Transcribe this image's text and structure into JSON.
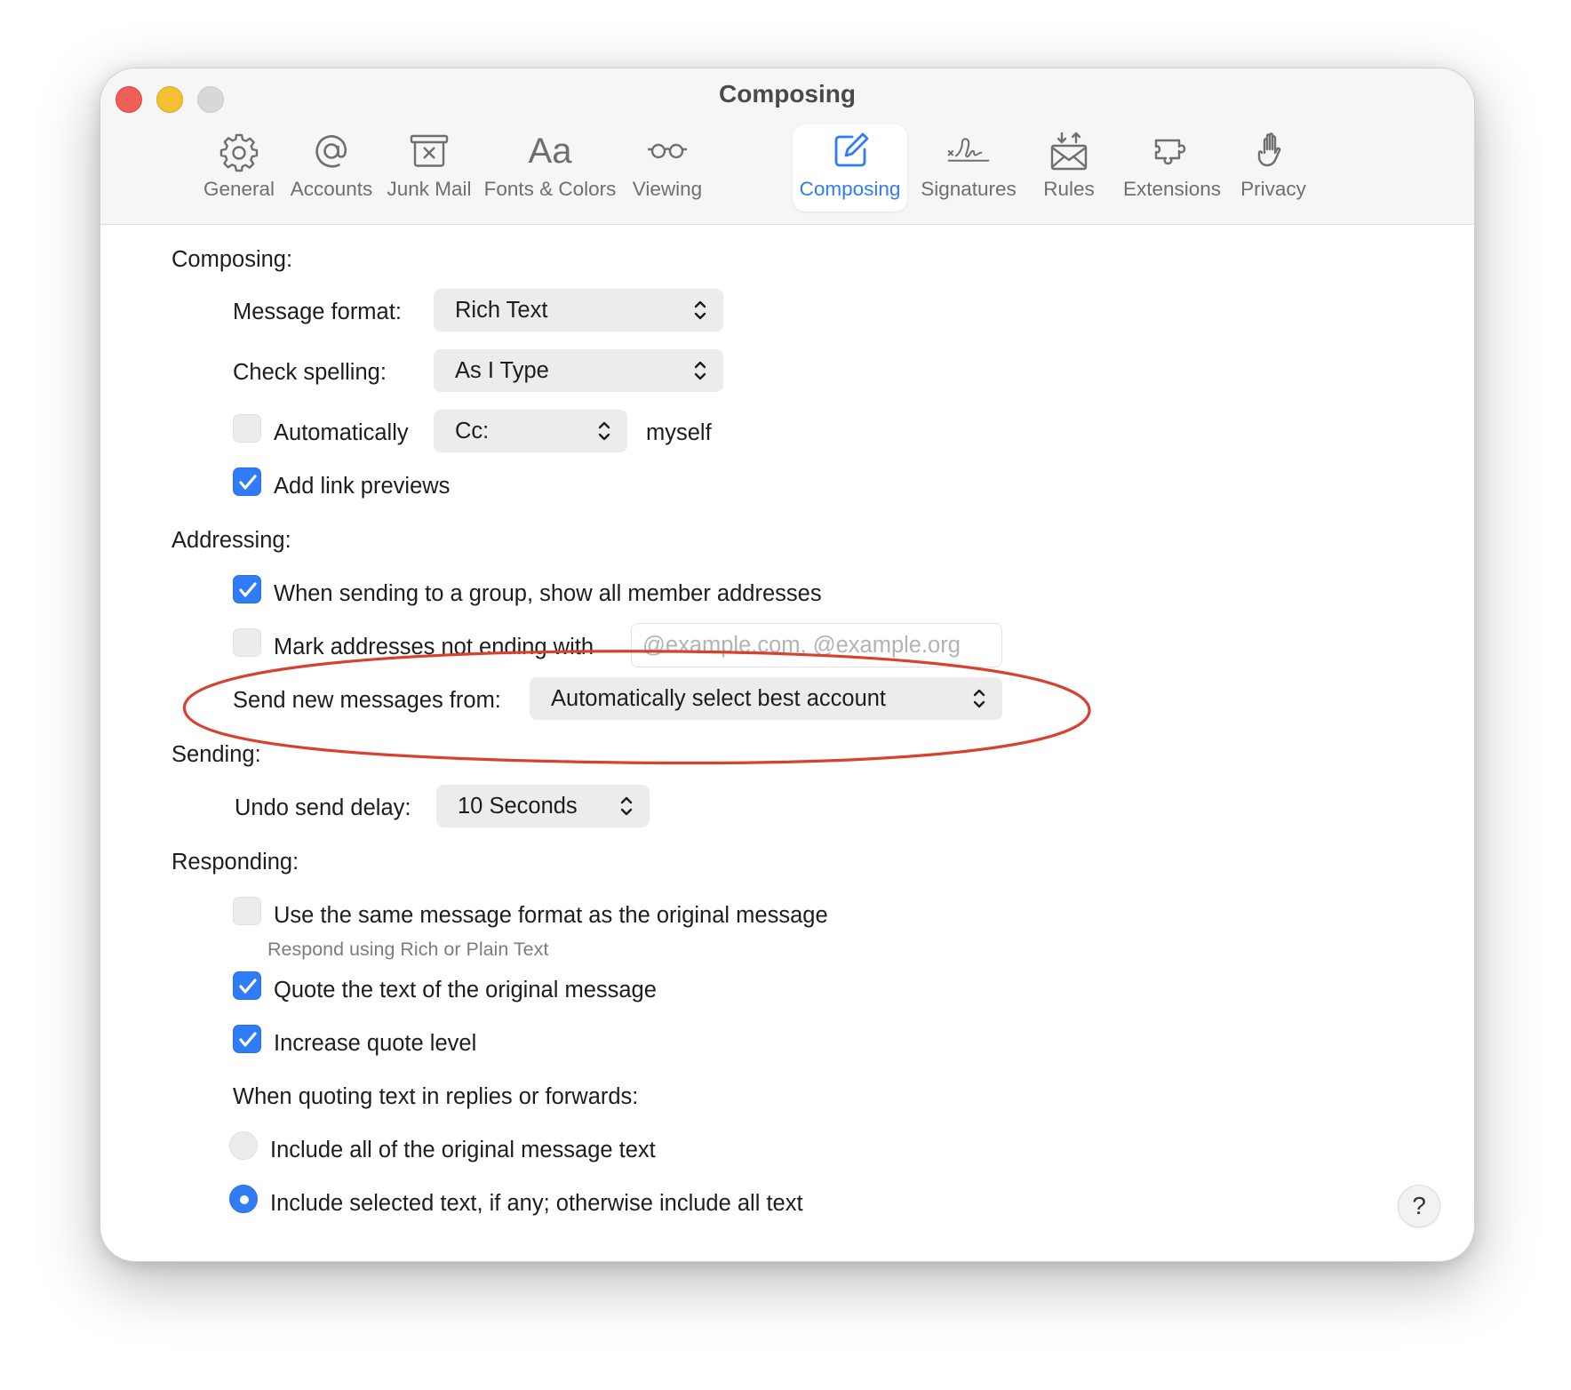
{
  "window": {
    "title": "Composing"
  },
  "toolbar": {
    "tabs": [
      {
        "label": "General",
        "icon": "gear-icon"
      },
      {
        "label": "Accounts",
        "icon": "at-sign-icon"
      },
      {
        "label": "Junk Mail",
        "icon": "junk-box-icon"
      },
      {
        "label": "Fonts & Colors",
        "icon": "aa-icon",
        "glyph": "Aa"
      },
      {
        "label": "Viewing",
        "icon": "glasses-icon"
      },
      {
        "label": "Composing",
        "icon": "compose-icon",
        "active": true
      },
      {
        "label": "Signatures",
        "icon": "signature-icon"
      },
      {
        "label": "Rules",
        "icon": "envelope-rules-icon"
      },
      {
        "label": "Extensions",
        "icon": "puzzle-icon"
      },
      {
        "label": "Privacy",
        "icon": "hand-icon"
      }
    ]
  },
  "composing": {
    "heading": "Composing:",
    "message_format_label": "Message format:",
    "message_format_value": "Rich Text",
    "check_spelling_label": "Check spelling:",
    "check_spelling_value": "As I Type",
    "auto_cc_label": "Automatically",
    "auto_cc_value": "Cc:",
    "auto_cc_suffix": "myself",
    "auto_cc_checked": false,
    "link_previews_label": "Add link previews",
    "link_previews_checked": true
  },
  "addressing": {
    "heading": "Addressing:",
    "group_label": "When sending to a group, show all member addresses",
    "group_checked": true,
    "mark_label": "Mark addresses not ending with",
    "mark_checked": false,
    "mark_placeholder": "@example.com, @example.org",
    "send_from_label": "Send new messages from:",
    "send_from_value": "Automatically select best account"
  },
  "sending": {
    "heading": "Sending:",
    "undo_label": "Undo send delay:",
    "undo_value": "10 Seconds"
  },
  "responding": {
    "heading": "Responding:",
    "same_format_label": "Use the same message format as the original message",
    "same_format_checked": false,
    "same_format_sub": "Respond using Rich or Plain Text",
    "quote_label": "Quote the text of the original message",
    "quote_checked": true,
    "increase_label": "Increase quote level",
    "increase_checked": true,
    "quoting_heading": "When quoting text in replies or forwards:",
    "include_all_label": "Include all of the original message text",
    "include_selected_label": "Include selected text, if any; otherwise include all text",
    "selected_option": "include_selected"
  },
  "help": {
    "label": "?"
  },
  "colors": {
    "accent": "#2f7cf6",
    "annotation": "#d9412f",
    "close": "#ed5f57",
    "minimize": "#f4c02f",
    "zoom": "#d8d8d8"
  }
}
